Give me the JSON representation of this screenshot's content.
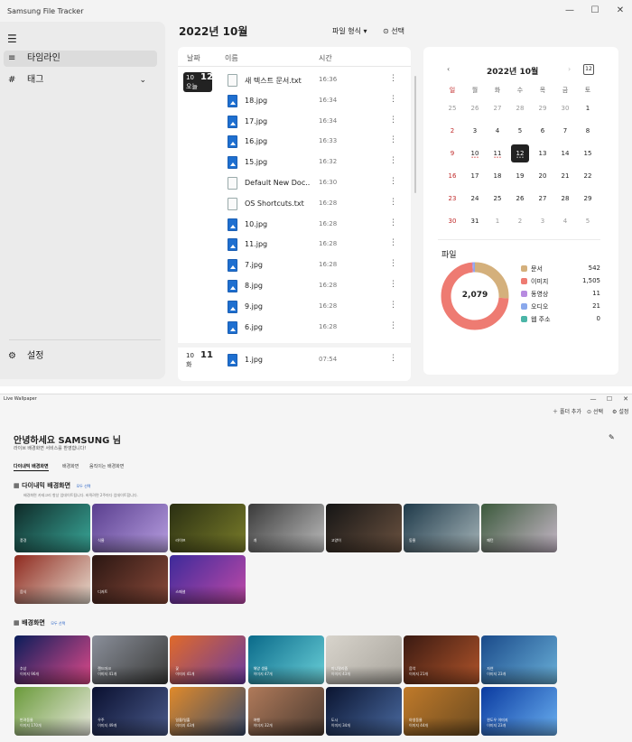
{
  "app1": {
    "title": "Samsung File Tracker",
    "window_controls": [
      "—",
      "☐",
      "✕"
    ],
    "sidebar": {
      "menu_icon": "menu-icon",
      "items": [
        {
          "label": "타임라인",
          "icon": "timeline-icon"
        },
        {
          "label": "태그",
          "icon": "hash-icon"
        }
      ],
      "settings_label": "설정"
    },
    "header": {
      "month": "2022년 10월",
      "format_label": "파일 형식",
      "select_label": "선택"
    },
    "list_headers": {
      "date": "날짜",
      "name": "이름",
      "time": "시간"
    },
    "groups": [
      {
        "month": "10",
        "day": "12",
        "weekday": "오늘",
        "selected": true
      },
      {
        "month": "10",
        "day": "11",
        "weekday": "화",
        "selected": false
      }
    ],
    "files": [
      {
        "name": "새 텍스트 문서.txt",
        "time": "16:36",
        "kind": "doc"
      },
      {
        "name": "18.jpg",
        "time": "16:34",
        "kind": "img"
      },
      {
        "name": "17.jpg",
        "time": "16:34",
        "kind": "img"
      },
      {
        "name": "16.jpg",
        "time": "16:33",
        "kind": "img"
      },
      {
        "name": "15.jpg",
        "time": "16:32",
        "kind": "img"
      },
      {
        "name": "Default New Doc...",
        "time": "16:30",
        "kind": "doc"
      },
      {
        "name": "OS Shortcuts.txt",
        "time": "16:28",
        "kind": "doc"
      },
      {
        "name": "10.jpg",
        "time": "16:28",
        "kind": "img"
      },
      {
        "name": "11.jpg",
        "time": "16:28",
        "kind": "img"
      },
      {
        "name": "7.jpg",
        "time": "16:28",
        "kind": "img"
      },
      {
        "name": "8.jpg",
        "time": "16:28",
        "kind": "img"
      },
      {
        "name": "9.jpg",
        "time": "16:28",
        "kind": "img"
      },
      {
        "name": "6.jpg",
        "time": "16:28",
        "kind": "img"
      },
      {
        "name": "1.jpg",
        "time": "07:54",
        "kind": "img"
      }
    ],
    "calendar": {
      "title": "2022년 10월",
      "prev": "‹",
      "next": "›",
      "today_button": "12",
      "weekdays": [
        "일",
        "월",
        "화",
        "수",
        "목",
        "금",
        "토"
      ],
      "days": [
        "25",
        "26",
        "27",
        "28",
        "29",
        "30",
        "1",
        "2",
        "3",
        "4",
        "5",
        "6",
        "7",
        "8",
        "9",
        "10",
        "11",
        "12",
        "13",
        "14",
        "15",
        "16",
        "17",
        "18",
        "19",
        "20",
        "21",
        "22",
        "23",
        "24",
        "25",
        "26",
        "27",
        "28",
        "29",
        "30",
        "31",
        "1",
        "2",
        "3",
        "4",
        "5"
      ],
      "selected_day": "12",
      "days_with_files": [
        "10",
        "11",
        "12"
      ]
    },
    "files_summary": {
      "title": "파일",
      "total": "2,079",
      "categories": [
        {
          "name": "문서",
          "count": "542",
          "value": 542,
          "color": "#d4b07c"
        },
        {
          "name": "이미지",
          "count": "1,505",
          "value": 1505,
          "color": "#ee7b72"
        },
        {
          "name": "동영상",
          "count": "11",
          "value": 11,
          "color": "#b78be0"
        },
        {
          "name": "오디오",
          "count": "21",
          "value": 21,
          "color": "#8aa8ec"
        },
        {
          "name": "웹 주소",
          "count": "0",
          "value": 0,
          "color": "#4bb5a7"
        }
      ]
    }
  },
  "app2": {
    "title": "Live Wallpaper",
    "window_controls": [
      "—",
      "☐",
      "✕"
    ],
    "toolbar": {
      "add": "폴더 추가",
      "select": "선택",
      "settings": "설정"
    },
    "greeting": "안녕하세요  SAMSUNG  님",
    "greeting_sub": "라이브 배경화면 서비스를 환영합니다!",
    "tabs": [
      "다이내믹 배경화면",
      "배경화면",
      "움직이는 배경화면"
    ],
    "dynamic_section": {
      "title": "다이내믹 배경화면",
      "link": "모두 선택",
      "desc": "배경화면 카테고리 항상 업데이트됩니다. 바뀌려면 2주마다 업데이트합니다.",
      "tiles": [
        {
          "label": "풍경",
          "colors": [
            "#0f2a28",
            "#3aa99a"
          ]
        },
        {
          "label": "식물",
          "colors": [
            "#5a3f8f",
            "#b79ee0"
          ]
        },
        {
          "label": "라이프",
          "colors": [
            "#2a2f12",
            "#7a7d2a"
          ]
        },
        {
          "label": "개",
          "colors": [
            "#3a3a3a",
            "#bdbdbd"
          ]
        },
        {
          "label": "고양이",
          "colors": [
            "#151515",
            "#6b5240"
          ]
        },
        {
          "label": "동물",
          "colors": [
            "#1f3a4a",
            "#a5b4b8"
          ]
        },
        {
          "label": "패턴",
          "colors": [
            "#3c5a3c",
            "#c7b8c8"
          ]
        },
        {
          "label": "음식",
          "colors": [
            "#8f2a1f",
            "#e8ddd0"
          ]
        },
        {
          "label": "디저트",
          "colors": [
            "#2a1612",
            "#8a4a3a"
          ]
        },
        {
          "label": "스페셜",
          "colors": [
            "#3c2a9a",
            "#c24aa8"
          ]
        }
      ]
    },
    "wallpaper_section": {
      "title": "배경화면",
      "link": "모두 선택",
      "tiles": [
        {
          "label": "추상",
          "count": "이미지 96개",
          "colors": [
            "#0a1d5a",
            "#e04a8a"
          ]
        },
        {
          "label": "랜드마크",
          "count": "이미지 41개",
          "colors": [
            "#8a8f9a",
            "#3a3a38"
          ]
        },
        {
          "label": "꽃",
          "count": "이미지 41개",
          "colors": [
            "#e06a2a",
            "#6a3aa0"
          ]
        },
        {
          "label": "해양 생물",
          "count": "이미지 47개",
          "colors": [
            "#0a6a8a",
            "#6ad0d8"
          ]
        },
        {
          "label": "미니멀리즘",
          "count": "이미지 43개",
          "colors": [
            "#d8d4cc",
            "#a8a49c"
          ]
        },
        {
          "label": "음악",
          "count": "이미지 21개",
          "colors": [
            "#3a1a12",
            "#b0542a"
          ]
        },
        {
          "label": "자연",
          "count": "이미지 23개",
          "colors": [
            "#1a4a8a",
            "#6ab0d8"
          ]
        },
        {
          "label": "반려동물",
          "count": "이미지 170개",
          "colors": [
            "#6a9a3a",
            "#eaeae0"
          ]
        },
        {
          "label": "우주",
          "count": "이미지 49개",
          "colors": [
            "#0a1030",
            "#4a5a8a"
          ]
        },
        {
          "label": "일몰/일출",
          "count": "이미지 43개",
          "colors": [
            "#e08a2a",
            "#3a4a6a"
          ]
        },
        {
          "label": "여행",
          "count": "이미지 32개",
          "colors": [
            "#b07a5a",
            "#4a3a30"
          ]
        },
        {
          "label": "도시",
          "count": "이미지 34개",
          "colors": [
            "#0a1430",
            "#4a6aa0"
          ]
        },
        {
          "label": "야생동물",
          "count": "이미지 44개",
          "colors": [
            "#c07a2a",
            "#6a4a20"
          ]
        },
        {
          "label": "윈도우 이미지",
          "count": "이미지 23개",
          "colors": [
            "#0a3aa0",
            "#6ab0f0"
          ]
        }
      ]
    }
  }
}
